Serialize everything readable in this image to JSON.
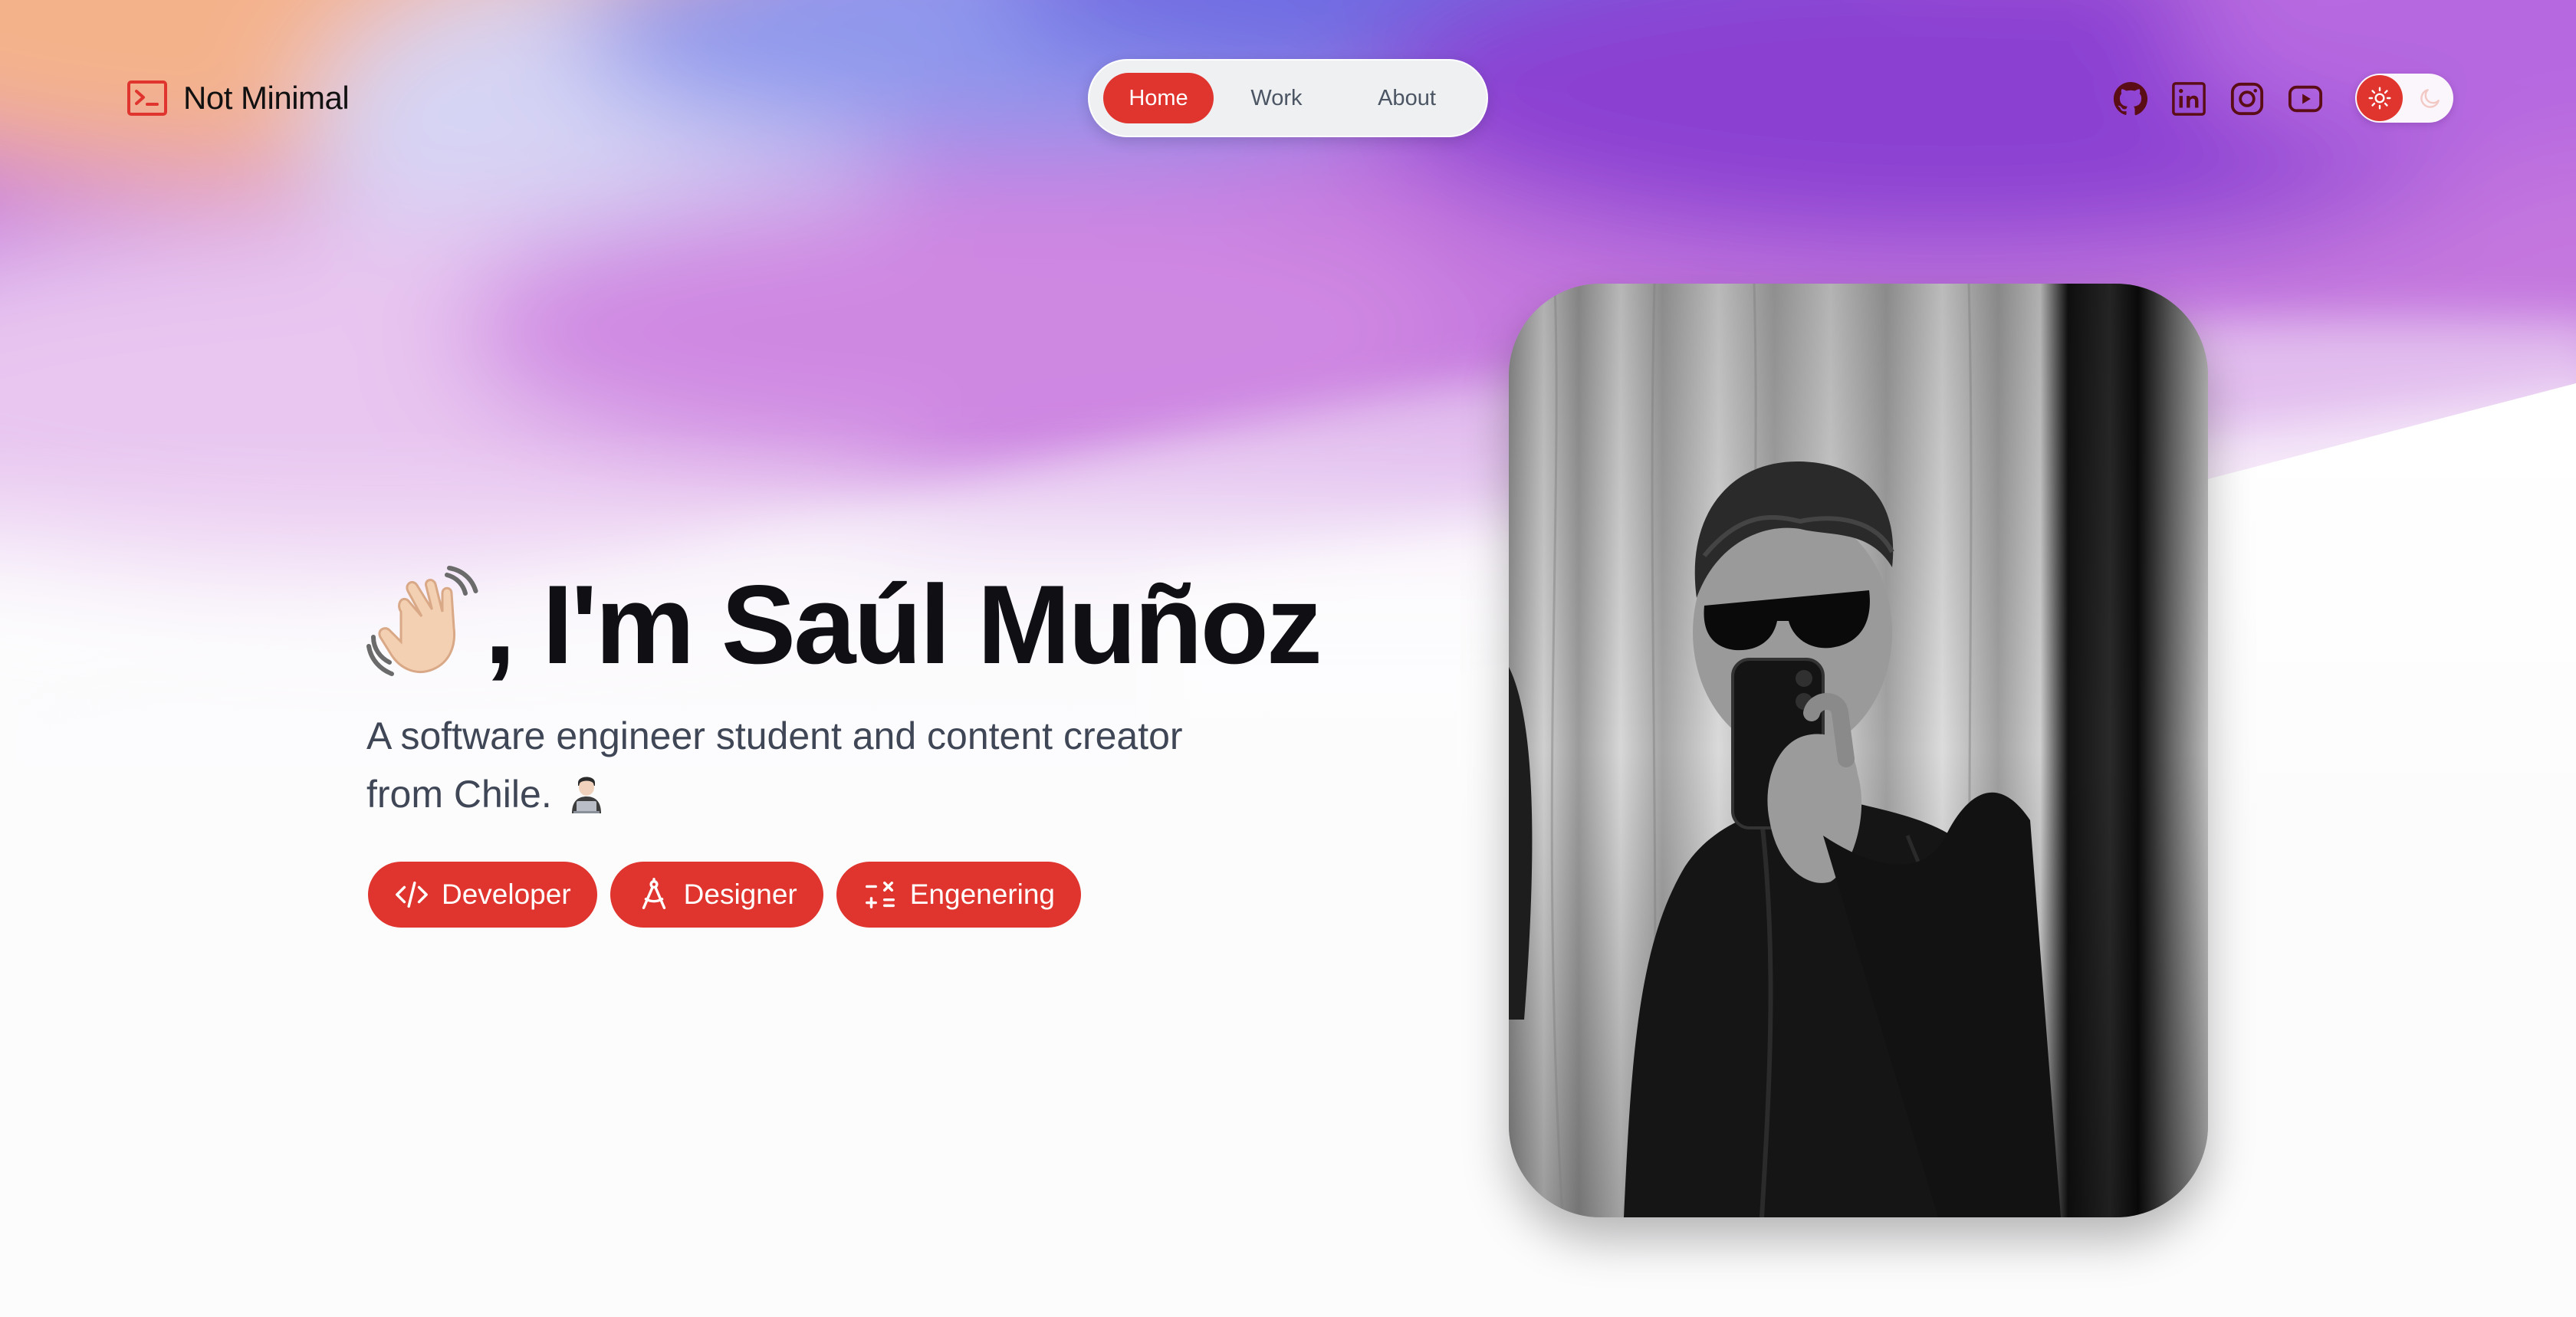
{
  "site": {
    "brand": "Not Minimal"
  },
  "icons": {
    "logo": "terminal-icon",
    "socials": [
      "github-icon",
      "linkedin-icon",
      "instagram-icon",
      "youtube-icon"
    ],
    "theme": [
      "sun-icon",
      "moon-icon"
    ],
    "tags": [
      "code-icon",
      "compass-icon",
      "calculator-icon"
    ],
    "hero_emoji": "waving-hand-icon",
    "subtitle_emoji": "technologist-icon"
  },
  "nav": {
    "items": [
      {
        "label": "Home",
        "active": true
      },
      {
        "label": "Work",
        "active": false
      },
      {
        "label": "About",
        "active": false
      }
    ]
  },
  "hero": {
    "title": ", I'm Saúl Muñoz",
    "subtitle": "A software engineer student and content creator from Chile.",
    "tags": [
      {
        "label": "Developer"
      },
      {
        "label": "Designer"
      },
      {
        "label": "Engenering"
      }
    ]
  },
  "colors": {
    "accent": "#e0342e",
    "text": "#0f0f14",
    "muted": "#3f4656"
  }
}
